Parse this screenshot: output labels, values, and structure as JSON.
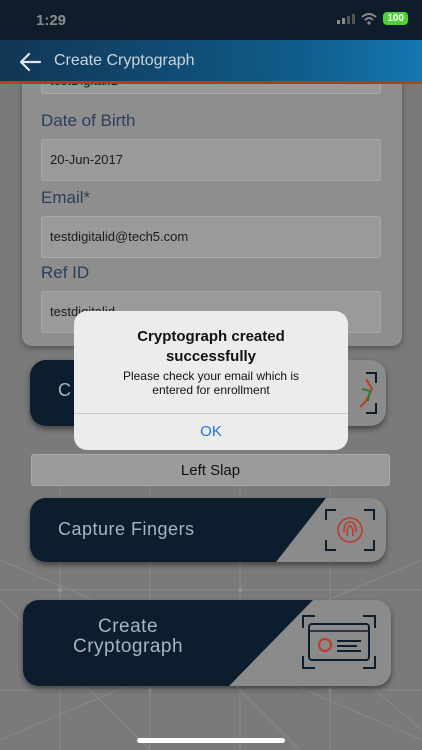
{
  "status_bar": {
    "time": "1:29",
    "battery": "100"
  },
  "app_bar": {
    "title": "Create Cryptograph"
  },
  "form": {
    "partial_value": "testDigitalID",
    "dob_label": "Date of Birth",
    "dob_value": "20-Jun-2017",
    "email_label": "Email*",
    "email_value": "testdigitalid@tech5.com",
    "refid_label": "Ref ID",
    "refid_value": "testdigitalid"
  },
  "buttons": {
    "capture_face_partial": "C",
    "left_slap": "Left Slap",
    "capture_fingers": "Capture Fingers",
    "create_cryptograph": "Create Cryptograph"
  },
  "alert": {
    "title": "Cryptograph created successfully",
    "message": "Please check your email which is entered for enrollment",
    "ok": "OK"
  },
  "colors": {
    "dark_navy": "#0c1d2e",
    "accent_red": "#c0392b",
    "ok_blue": "#1a73e8"
  }
}
